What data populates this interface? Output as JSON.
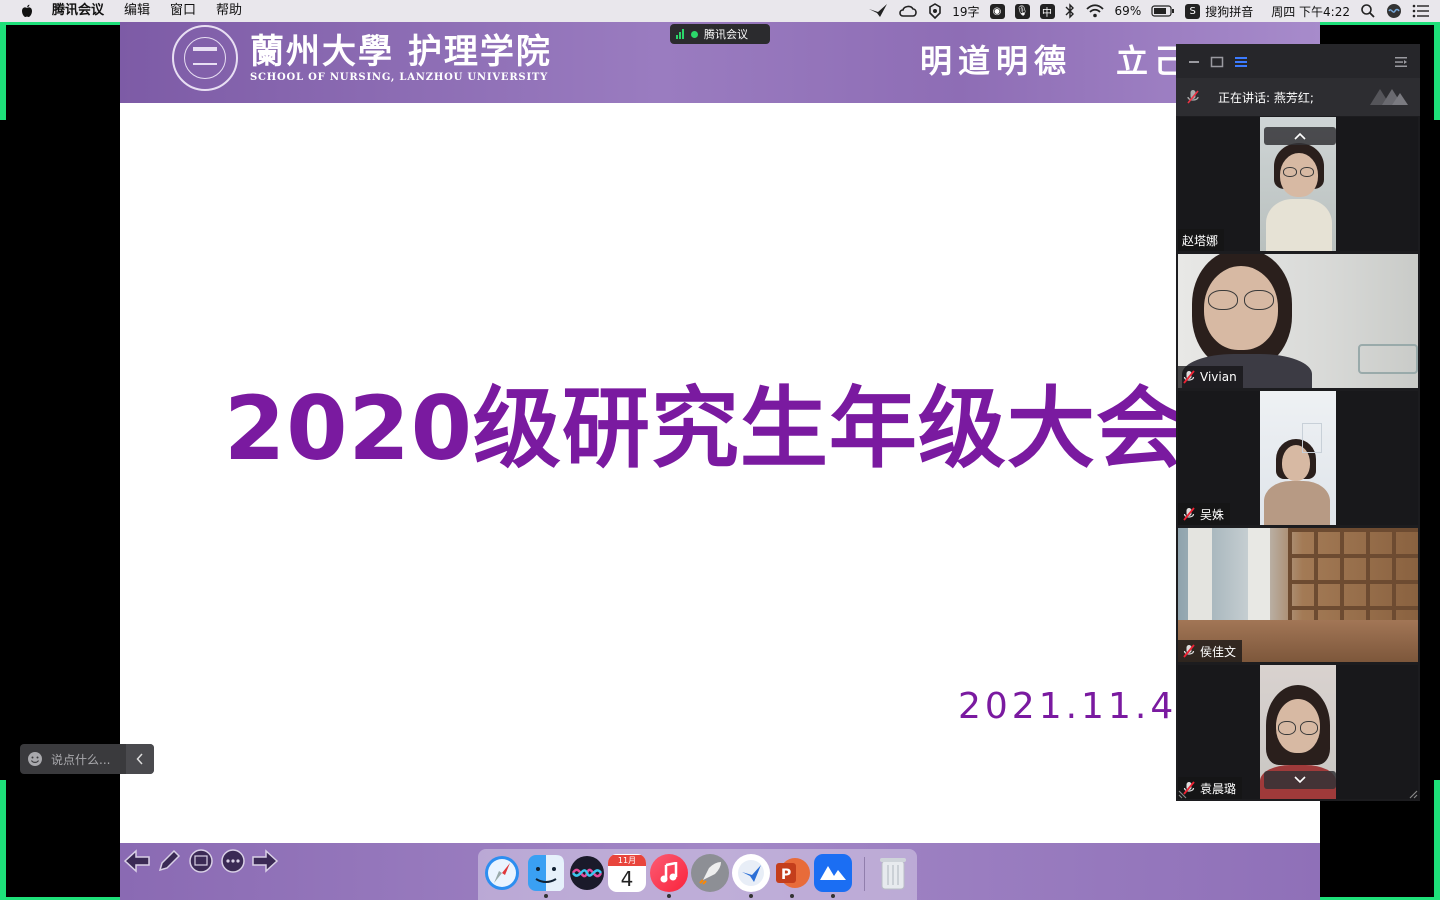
{
  "menubar": {
    "app_name": "腾讯会议",
    "items": [
      "编辑",
      "窗口",
      "帮助"
    ],
    "word_count": "19字",
    "ime_badge": "中",
    "battery": "69%",
    "input_method": "搜狗拼音",
    "clock": "周四 下午4:22"
  },
  "meeting_pill": {
    "label": "腾讯会议"
  },
  "slide": {
    "school_name_cn": "蘭州大學 护理学院",
    "school_name_en": "SCHOOL OF NURSING, LANZHOU UNIVERSITY",
    "motto_1": "明道明德",
    "motto_2": "立己达人",
    "title": "2020级研究生年级大会",
    "date": "2021.11.4"
  },
  "video_panel": {
    "speaking_label": "正在讲话: 燕芳红;",
    "participants": [
      {
        "name": "赵塔娜",
        "muted": false
      },
      {
        "name": "Vivian",
        "muted": true
      },
      {
        "name": "吴姝",
        "muted": true
      },
      {
        "name": "侯佳文",
        "muted": true
      },
      {
        "name": "袁晨璐",
        "muted": true
      }
    ]
  },
  "chat": {
    "placeholder": "说点什么..."
  },
  "dock": {
    "apps": [
      "safari-icon",
      "finder-icon",
      "siri-icon",
      "calendar-icon",
      "music-icon",
      "launchpad-icon",
      "feishu-icon",
      "powerpoint-icon",
      "tencent-meeting-icon",
      "trash-icon"
    ],
    "calendar_month": "11月",
    "calendar_day": "4"
  },
  "colors": {
    "share_border": "#1ee07a",
    "title_purple": "#7a1aa0",
    "banner_purple": "#8e6db5"
  }
}
